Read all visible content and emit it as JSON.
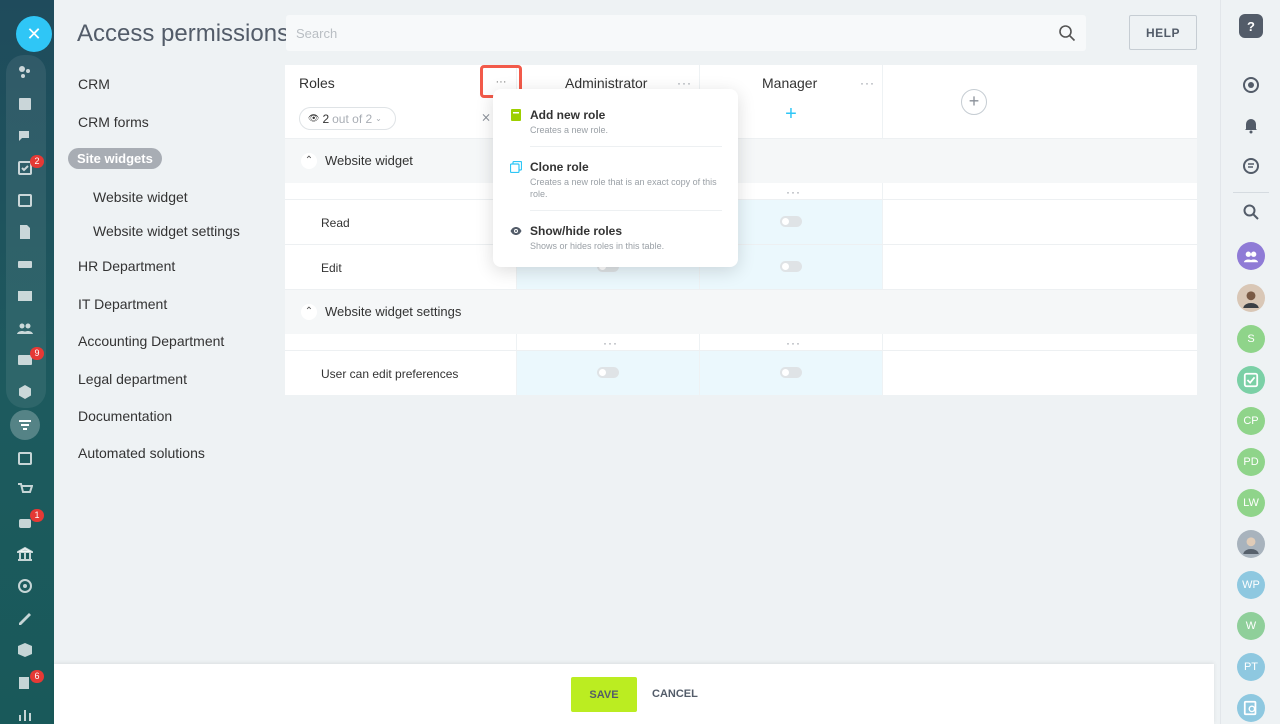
{
  "page": {
    "title": "Access permissions"
  },
  "search": {
    "placeholder": "Search"
  },
  "help_label": "HELP",
  "left_menu": [
    {
      "label": "CRM"
    },
    {
      "label": "CRM forms"
    },
    {
      "label": "Site widgets",
      "active": true
    },
    {
      "label": "Website widget",
      "sub": true
    },
    {
      "label": "Website widget settings",
      "sub": true
    },
    {
      "label": "HR Department"
    },
    {
      "label": "IT Department"
    },
    {
      "label": "Accounting Department"
    },
    {
      "label": "Legal department"
    },
    {
      "label": "Documentation"
    },
    {
      "label": "Automated solutions"
    }
  ],
  "table": {
    "roles_header": "Roles",
    "roles_dots": "···",
    "roles_count_num": "2",
    "roles_count_rest": "out of 2",
    "columns": [
      {
        "label": "Administrator",
        "dots": "···"
      },
      {
        "label": "Manager",
        "dots": "···"
      }
    ],
    "sections": [
      {
        "title": "Website widget",
        "rows": [
          "Read",
          "Edit"
        ]
      },
      {
        "title": "Website widget settings",
        "rows": [
          "User can edit preferences"
        ]
      }
    ],
    "cell_dots": "···"
  },
  "dropdown": {
    "items": [
      {
        "title": "Add new role",
        "desc": "Creates a new role.",
        "icon": "add-role-icon",
        "color": "#9dcf00"
      },
      {
        "title": "Clone role",
        "desc": "Creates a new role that is an exact copy of this role.",
        "icon": "clone-icon",
        "color": "#2fc6f6"
      },
      {
        "title": "Show/hide roles",
        "desc": "Shows or hides roles in this table.",
        "icon": "eye-icon",
        "color": "#535c69"
      }
    ]
  },
  "footer": {
    "save_label": "SAVE",
    "cancel_label": "CANCEL"
  },
  "left_badges": {
    "tasks": "2",
    "contacts": "9",
    "robot": "1",
    "docs": "6"
  },
  "right_sidebar": {
    "avatars": [
      {
        "initials": "",
        "color": "#8f7bd6",
        "icon": "group-icon"
      },
      {
        "initials": "",
        "color": "#d9c7b6",
        "icon": "user-photo"
      },
      {
        "initials": "S",
        "color": "#8fd48a"
      },
      {
        "initials": "",
        "color": "#7bd0a6",
        "icon": "task-icon"
      },
      {
        "initials": "CP",
        "color": "#8fd48a"
      },
      {
        "initials": "PD",
        "color": "#8fd48a"
      },
      {
        "initials": "LW",
        "color": "#8fd48a"
      },
      {
        "initials": "",
        "color": "#a8b3bd",
        "icon": "user-photo"
      },
      {
        "initials": "WP",
        "color": "#8ec8e0"
      },
      {
        "initials": "W",
        "color": "#8fcf9a"
      },
      {
        "initials": "PT",
        "color": "#8ec8e0"
      },
      {
        "initials": "",
        "color": "#8ec8e0",
        "icon": "search-doc-icon"
      }
    ]
  }
}
